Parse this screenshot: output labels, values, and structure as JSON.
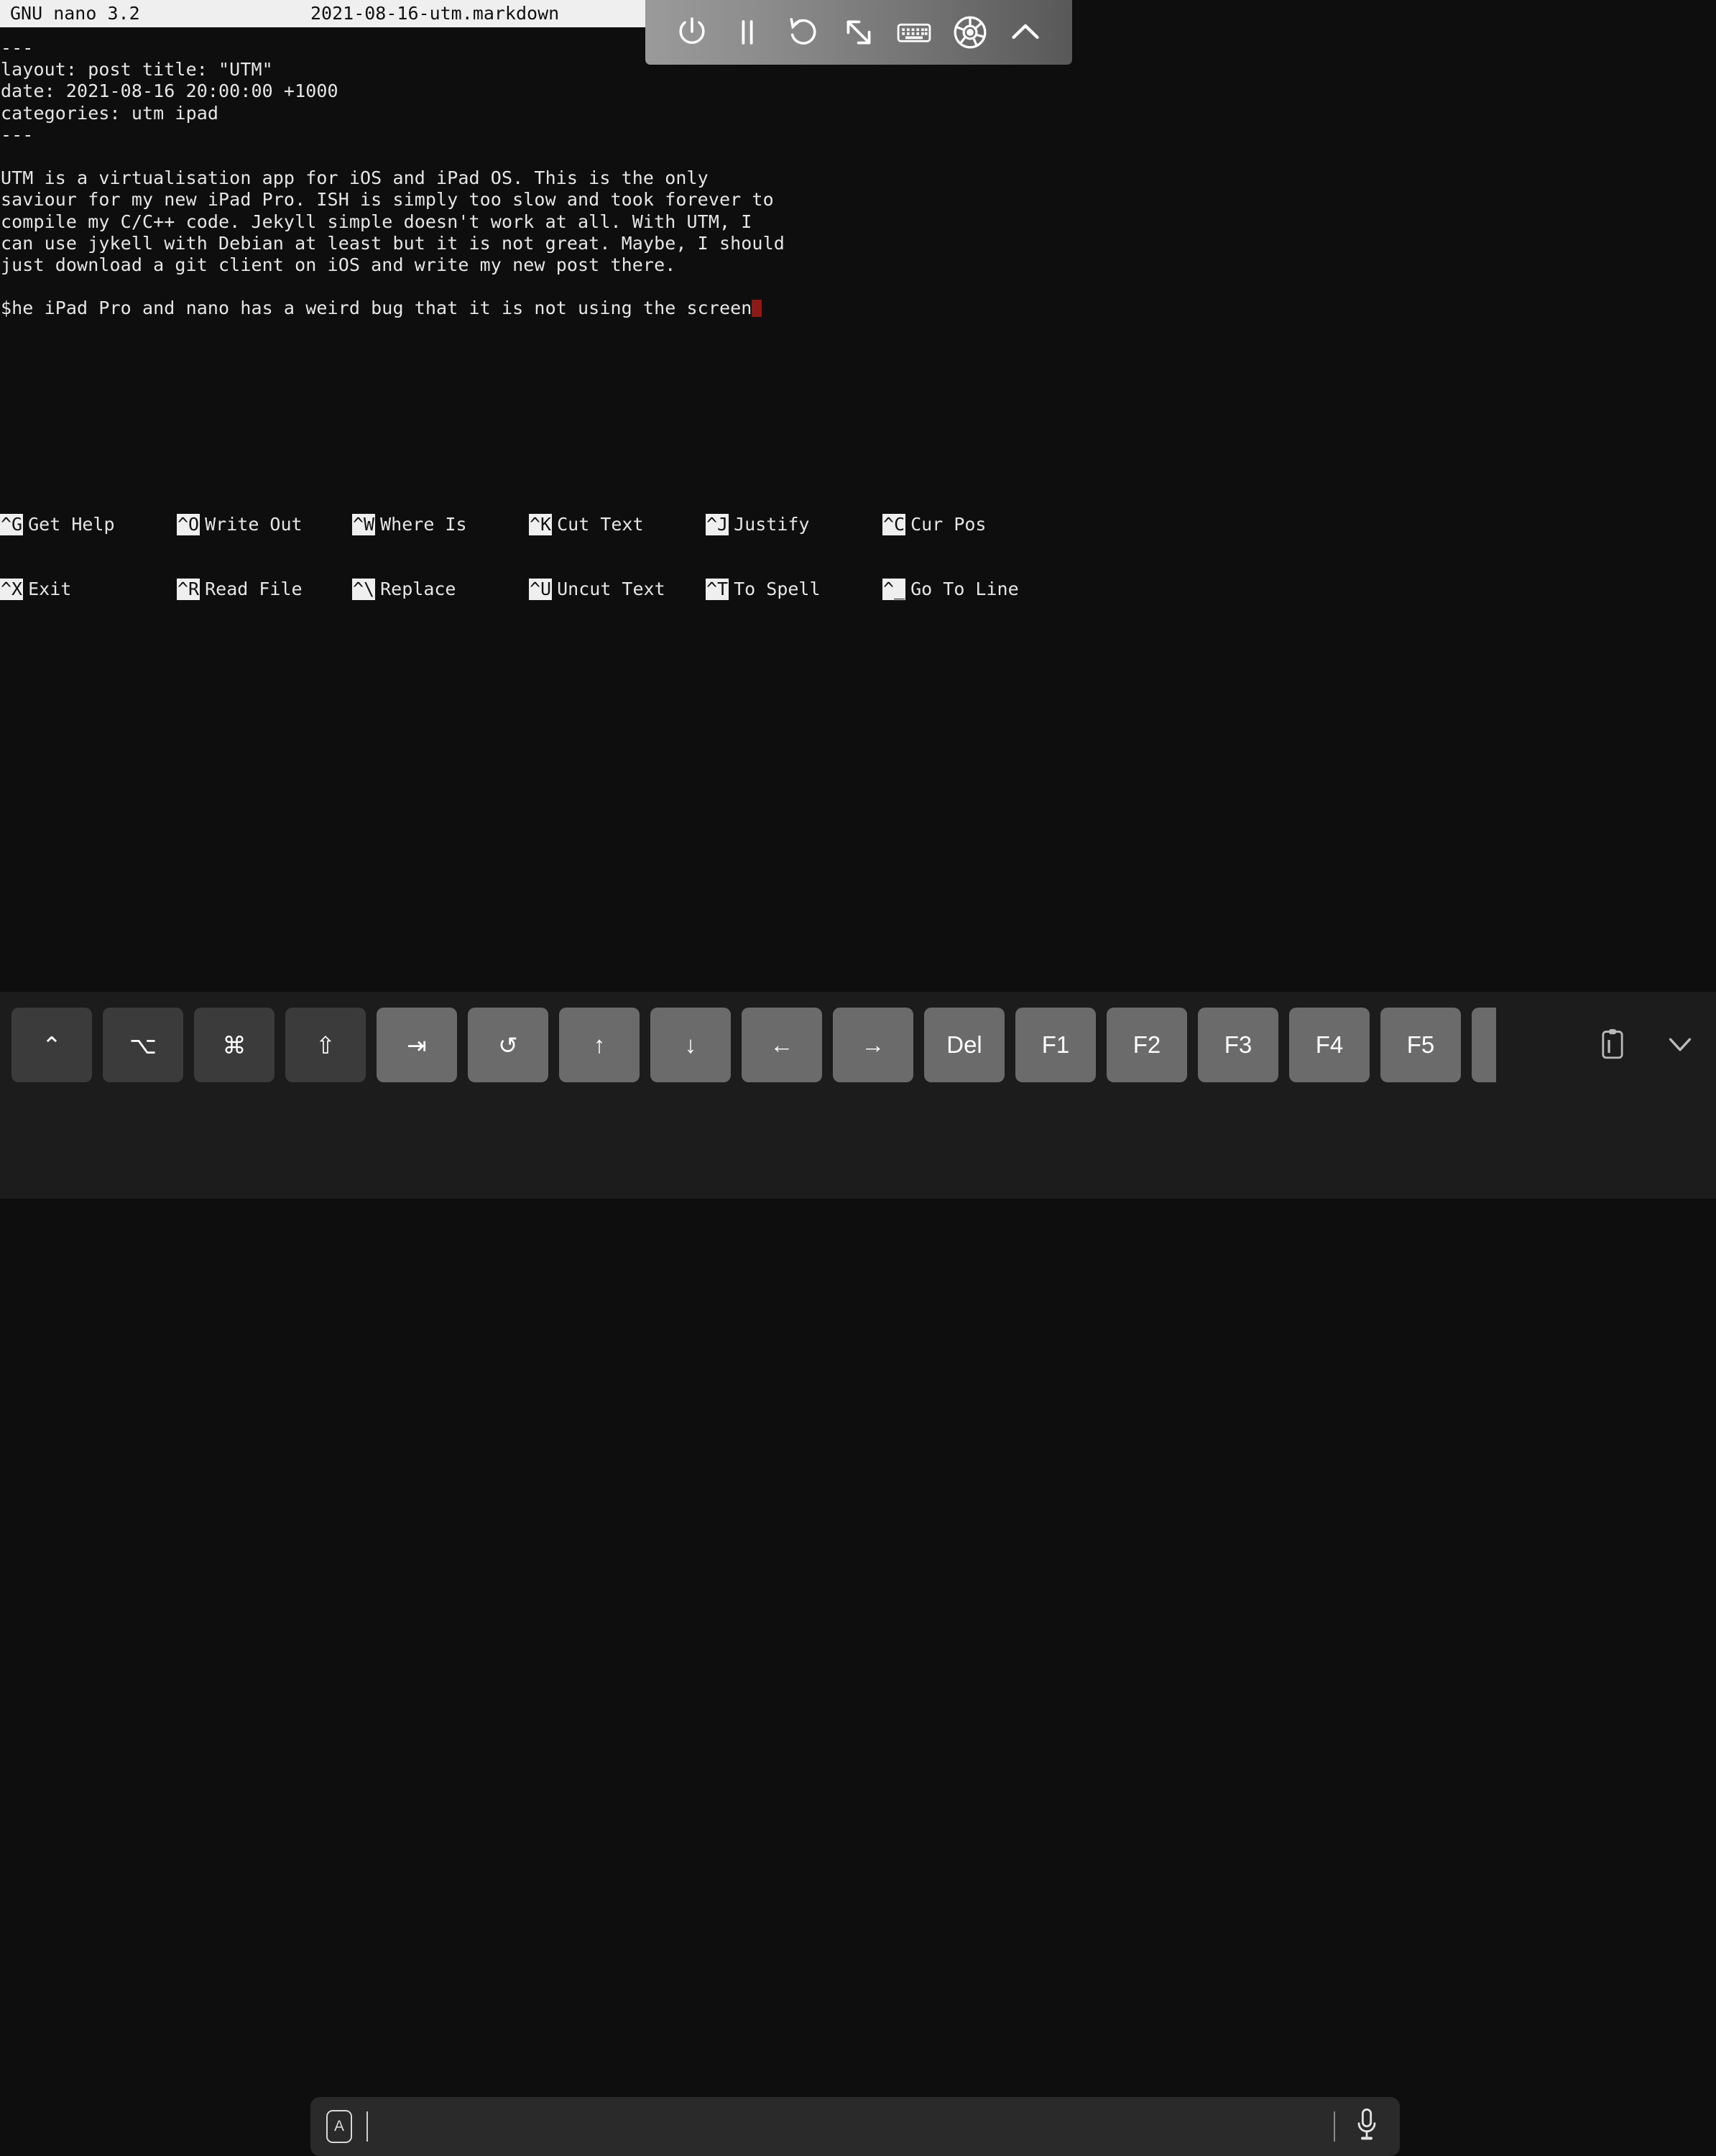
{
  "titlebar": {
    "version": "GNU nano 3.2",
    "filename": "2021-08-16-utm.markdown"
  },
  "editor": {
    "lines": [
      "---",
      "layout: post title: \"UTM\"",
      "date: 2021-08-16 20:00:00 +1000",
      "categories: utm ipad",
      "---",
      "",
      "UTM is a virtualisation app for iOS and iPad OS. This is the only",
      "saviour for my new iPad Pro. ISH is simply too slow and took forever to",
      "compile my C/C++ code. Jekyll simple doesn't work at all. With UTM, I",
      "can use jykell with Debian at least but it is not great. Maybe, I should",
      "just download a git client on iOS and write my new post there.",
      "",
      "$he iPad Pro and nano has a weird bug that it is not using the screen"
    ],
    "cursor_line_index": 12,
    "cursor_color": "#8c1a16",
    "foreground": "#e6e6e6",
    "background": "#0e0e0e"
  },
  "shortcuts": {
    "row1": [
      {
        "key": "^G",
        "label": "Get Help"
      },
      {
        "key": "^O",
        "label": "Write Out"
      },
      {
        "key": "^W",
        "label": "Where Is"
      },
      {
        "key": "^K",
        "label": "Cut Text"
      },
      {
        "key": "^J",
        "label": "Justify"
      },
      {
        "key": "^C",
        "label": "Cur Pos"
      }
    ],
    "row2": [
      {
        "key": "^X",
        "label": "Exit"
      },
      {
        "key": "^R",
        "label": "Read File"
      },
      {
        "key": "^\\",
        "label": "Replace"
      },
      {
        "key": "^U",
        "label": "Uncut Text"
      },
      {
        "key": "^T",
        "label": "To Spell"
      },
      {
        "key": "^_",
        "label": "Go To Line"
      }
    ]
  },
  "vm_toolbar": {
    "background_left": "#9a9a9a",
    "background_right": "#585858",
    "buttons": [
      {
        "icon": "power-icon",
        "label": "Power"
      },
      {
        "icon": "pause-icon",
        "label": "Pause"
      },
      {
        "icon": "restart-icon",
        "label": "Restart"
      },
      {
        "icon": "resize-icon",
        "label": "Resize Display"
      },
      {
        "icon": "keyboard-icon",
        "label": "Keyboard"
      },
      {
        "icon": "disc-icon",
        "label": "Drives"
      },
      {
        "icon": "chevron-up-icon",
        "label": "Hide Toolbar"
      }
    ]
  },
  "keyboard_bar": {
    "keys": [
      {
        "name": "control-key",
        "glyph": "⌃",
        "modifier": true
      },
      {
        "name": "option-key",
        "glyph": "⌥",
        "modifier": true
      },
      {
        "name": "command-key",
        "glyph": "⌘",
        "modifier": true
      },
      {
        "name": "shift-key",
        "glyph": "⇧",
        "modifier": true
      },
      {
        "name": "tab-key",
        "glyph": "⇥",
        "modifier": false
      },
      {
        "name": "escape-key",
        "glyph": "↺",
        "modifier": false
      },
      {
        "name": "arrow-up-key",
        "glyph": "↑",
        "modifier": false
      },
      {
        "name": "arrow-down-key",
        "glyph": "↓",
        "modifier": false
      },
      {
        "name": "arrow-left-key",
        "glyph": "←",
        "modifier": false
      },
      {
        "name": "arrow-right-key",
        "glyph": "→",
        "modifier": false
      },
      {
        "name": "delete-key",
        "glyph": "Del",
        "modifier": false
      },
      {
        "name": "f1-key",
        "glyph": "F1",
        "modifier": false
      },
      {
        "name": "f2-key",
        "glyph": "F2",
        "modifier": false
      },
      {
        "name": "f3-key",
        "glyph": "F3",
        "modifier": false
      },
      {
        "name": "f4-key",
        "glyph": "F4",
        "modifier": false
      },
      {
        "name": "f5-key",
        "glyph": "F5",
        "modifier": false
      },
      {
        "name": "f6-key-clipped",
        "glyph": "",
        "modifier": false
      }
    ],
    "right_icons": [
      {
        "name": "paste-icon",
        "label": "Paste"
      },
      {
        "name": "chevron-down-icon",
        "label": "Dismiss Keyboard"
      }
    ]
  },
  "input_bar": {
    "format_button": "A",
    "value": "",
    "placeholder": "",
    "mic_icon": "microphone-icon"
  }
}
